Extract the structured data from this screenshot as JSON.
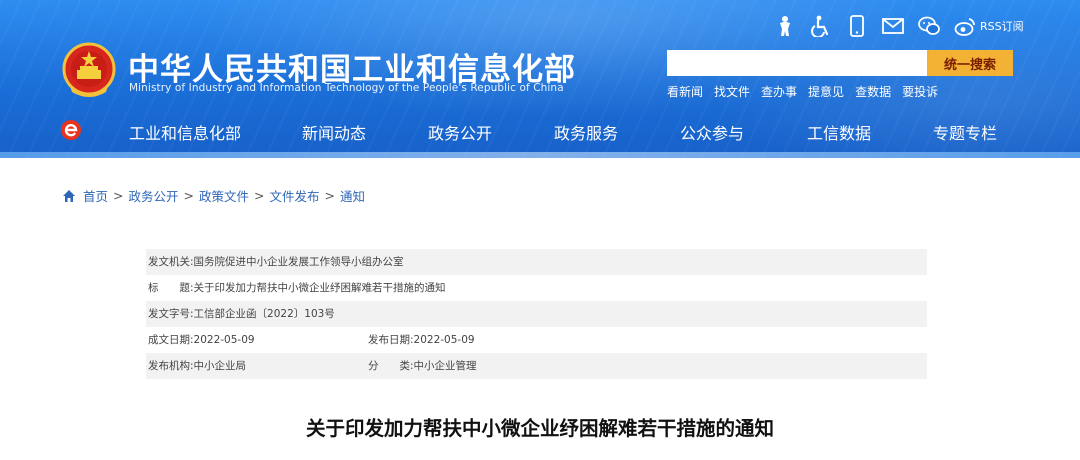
{
  "header": {
    "title": "中华人民共和国工业和信息化部",
    "subtitle": "Ministry of Industry and Information Technology of the People's Republic of China",
    "rss_label": "RSS订阅",
    "search": {
      "placeholder": "",
      "button_label": "统一搜索"
    },
    "quick_links": [
      "看新闻",
      "找文件",
      "查办事",
      "提意见",
      "查数据",
      "要投诉"
    ],
    "util_icons": [
      "accessibility-figure-icon",
      "wheelchair-icon",
      "mobile-phone-icon",
      "mail-icon",
      "wechat-icon",
      "weibo-icon"
    ]
  },
  "nav": {
    "items": [
      "工业和信息化部",
      "新闻动态",
      "政务公开",
      "政务服务",
      "公众参与",
      "工信数据",
      "专题专栏"
    ]
  },
  "breadcrumb": {
    "items": [
      "首页",
      "政务公开",
      "政策文件",
      "文件发布",
      "通知"
    ],
    "separator": ">"
  },
  "meta": {
    "issuer_label": "发文机关:",
    "issuer": "国务院促进中小企业发展工作领导小组办公室",
    "title_label": "标　　题:",
    "title": "关于印发加力帮扶中小微企业纾困解难若干措施的通知",
    "doc_no_label": "发文字号:",
    "doc_no": "工信部企业函〔2022〕103号",
    "created_label": "成文日期:",
    "created": "2022-05-09",
    "published_label": "发布日期:",
    "published": "2022-05-09",
    "org_label": "发布机构:",
    "org": "中小企业局",
    "category_label": "分　　类:",
    "category": "中小企业管理"
  },
  "article": {
    "title": "关于印发加力帮扶中小微企业纾困解难若干措施的通知"
  },
  "colors": {
    "header_blue": "#1b6fd8",
    "search_button": "#f3b233",
    "link_blue": "#2f67b8",
    "row_shade": "#f2f2f2"
  }
}
